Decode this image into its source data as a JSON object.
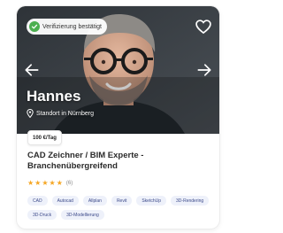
{
  "card": {
    "verified_badge": "Verifizierung bestätigt",
    "name": "Hannes",
    "location": "Standort in Nürnberg",
    "price": "100 €/Tag",
    "title": "CAD Zeichner / BIM Experte - Branchenübergreifend",
    "rating": {
      "stars": 5,
      "max": 5,
      "count": "(6)"
    },
    "tags": [
      "CAD",
      "Autocad",
      "Allplan",
      "Revit",
      "SketchUp",
      "3D-Rendering",
      "3D-Druck",
      "3D-Modellierung"
    ],
    "icons": {
      "verified": "check-circle-icon",
      "favorite": "heart-icon",
      "prev": "arrow-left-icon",
      "next": "arrow-right-icon",
      "location": "map-pin-icon",
      "star": "star-icon"
    },
    "colors": {
      "accent_green": "#4caf50",
      "star": "#f5a623",
      "tag_bg": "#eef1fa",
      "tag_text": "#3c4a8a"
    }
  }
}
